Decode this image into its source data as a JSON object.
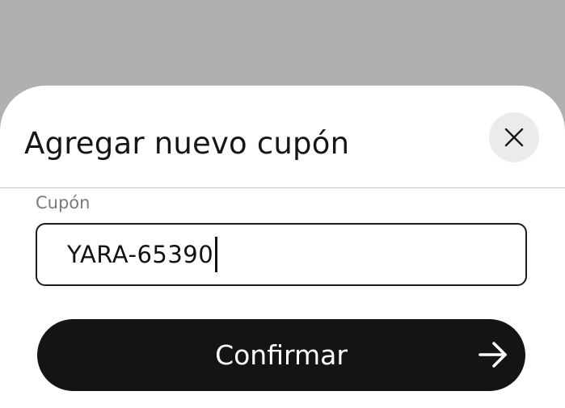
{
  "modal": {
    "title": "Agregar nuevo cupón",
    "close_icon": "close-icon",
    "coupon_field": {
      "label": "Cupón",
      "value": "YARA-65390"
    },
    "confirm_button": {
      "label": "Confirmar",
      "icon": "arrow-right-icon"
    }
  },
  "colors": {
    "backdrop": "#b0b0b0",
    "sheet": "#ffffff",
    "button": "#141414",
    "button_text": "#ffffff",
    "close_bg": "#ebebeb"
  }
}
